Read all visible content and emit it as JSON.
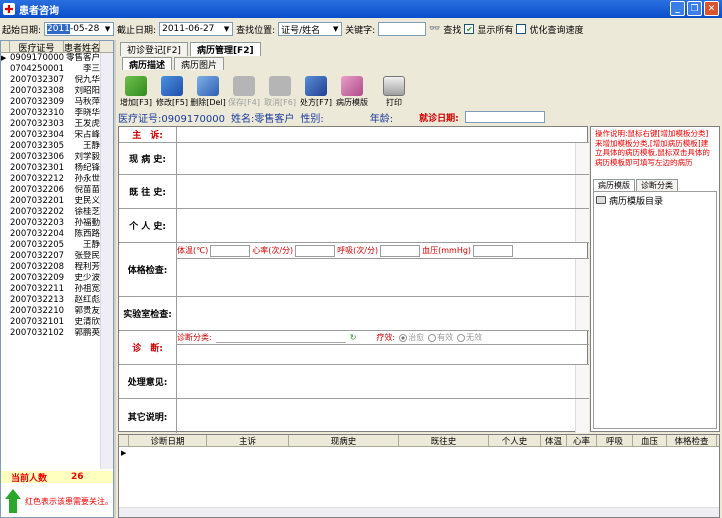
{
  "window": {
    "title": "患者咨询"
  },
  "filter": {
    "start_label": "起始日期:",
    "start_year": "2011",
    "start_rest": "-05-28",
    "end_label": "截止日期:",
    "end_value": "2011-06-27",
    "position_label": "查找位置:",
    "position_value": "证号/姓名",
    "keyword_label": "关键字:",
    "find_label": "查找",
    "show_all_label": "显示所有",
    "optimize_label": "优化查询速度"
  },
  "patients": {
    "col_id": "医疗证号",
    "col_name": "患者姓名",
    "rows": [
      {
        "id": "0909170000",
        "name": "零售客户"
      },
      {
        "id": "0704250001",
        "name": "李三"
      },
      {
        "id": "2007032307",
        "name": "倪九华"
      },
      {
        "id": "2007032308",
        "name": "刘昭阳"
      },
      {
        "id": "2007032309",
        "name": "马秋萍"
      },
      {
        "id": "2007032310",
        "name": "李晓华"
      },
      {
        "id": "2007032303",
        "name": "王发虎"
      },
      {
        "id": "2007032304",
        "name": "宋占峰"
      },
      {
        "id": "2007032305",
        "name": "王静"
      },
      {
        "id": "2007032306",
        "name": "刘学毅"
      },
      {
        "id": "2007032301",
        "name": "杨纪锋"
      },
      {
        "id": "2007032212",
        "name": "孙永世"
      },
      {
        "id": "2007032206",
        "name": "倪苗苗"
      },
      {
        "id": "2007032201",
        "name": "史民义"
      },
      {
        "id": "2007032202",
        "name": "徐桂芝"
      },
      {
        "id": "2007032203",
        "name": "孙福勤"
      },
      {
        "id": "2007032204",
        "name": "陈西路"
      },
      {
        "id": "2007032205",
        "name": "王静"
      },
      {
        "id": "2007032207",
        "name": "张登民"
      },
      {
        "id": "2007032208",
        "name": "程利芳"
      },
      {
        "id": "2007032209",
        "name": "史少波"
      },
      {
        "id": "2007032211",
        "name": "孙祖宽"
      },
      {
        "id": "2007032213",
        "name": "赵红彪"
      },
      {
        "id": "2007032210",
        "name": "郭贵友"
      },
      {
        "id": "2007032101",
        "name": "史清欣"
      },
      {
        "id": "2007032102",
        "name": "郭鹏英"
      }
    ],
    "count_label": "当前人数",
    "count_value": "26",
    "hint": "红色表示该患需要关注。"
  },
  "tabs": {
    "first_visit": "初诊登记[F2]",
    "records": "病历管理[F2]"
  },
  "subtabs": {
    "desc": "病历描述",
    "images": "病历图片"
  },
  "toolbar": {
    "add": "增加[F3]",
    "edit": "修改[F5]",
    "delete": "删除[Del]",
    "save": "保存[F4]",
    "cancel": "取消[F6]",
    "prescription": "处方[F7]",
    "template": "病历模版",
    "print": "打印"
  },
  "patient_info": {
    "id_label": "医疗证号:0909170000",
    "name_label": "姓名:零售客户",
    "gender_label": "性别:",
    "age_label": "年龄:",
    "visit_date_label": "就诊日期:"
  },
  "form": {
    "chief": "主　诉:",
    "present": "现 病 史:",
    "past": "既 往 史:",
    "personal": "个 人 史:",
    "temp": "体温(℃)",
    "heart": "心率(次/分)",
    "breath": "呼吸(次/分)",
    "bp": "血压(mmHg)",
    "physical": "体格检查:",
    "lab": "实验室检查:",
    "diagnosis": "诊　断:",
    "diag_category": "诊断分类:",
    "effect": "疗效:",
    "cured": "治愈",
    "effective": "有效",
    "none": "无效",
    "treatment": "处理意见:",
    "other": "其它说明:"
  },
  "rightpanel": {
    "instructions": "操作说明:鼠标右键[增加模板分类]来增加模板分类,[增加病历模板]建立具体的病历模板,鼠标双击具体的病历模板即可填写左边的病历",
    "tab_template": "病历模版",
    "tab_diag": "诊断分类",
    "tree_root": "病历模版目录"
  },
  "grid": {
    "columns": [
      "诊断日期",
      "主诉",
      "现病史",
      "既往史",
      "个人史",
      "体温",
      "心率",
      "呼吸",
      "血压",
      "体格检查"
    ]
  }
}
